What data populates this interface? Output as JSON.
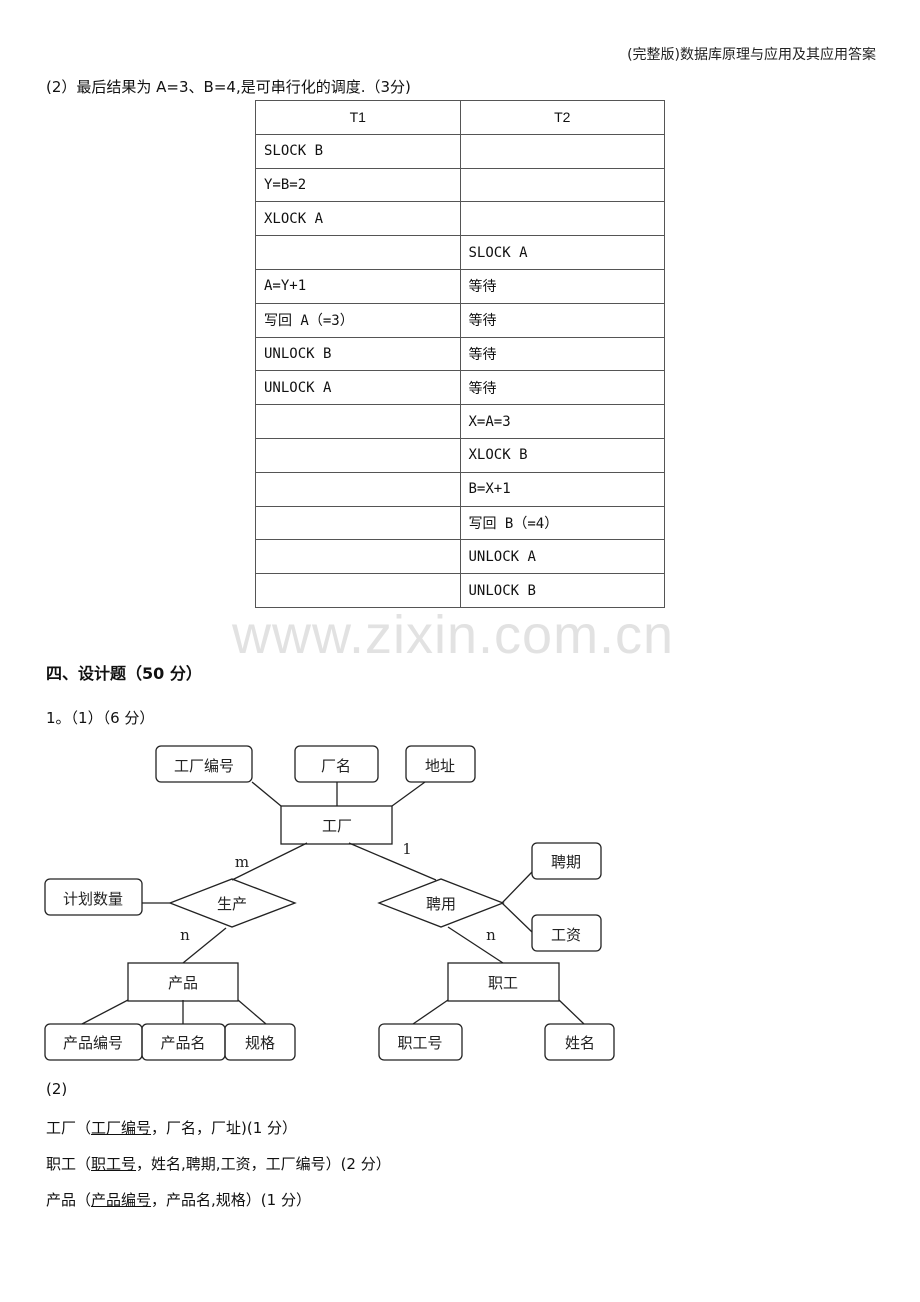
{
  "header": {
    "title": "(完整版)数据库原理与应用及其应用答案"
  },
  "q2_intro": "(2）最后结果为 A=3、B=4,是可串行化的调度.（3分)",
  "schedule_table": {
    "headers": [
      "T1",
      "T2"
    ],
    "rows": [
      [
        "SLOCK B",
        ""
      ],
      [
        "Y=B=2",
        ""
      ],
      [
        "XLOCK A",
        ""
      ],
      [
        "",
        "SLOCK A"
      ],
      [
        "A=Y+1",
        "等待"
      ],
      [
        "写回 A（=3）",
        "等待"
      ],
      [
        "UNLOCK B",
        "等待"
      ],
      [
        "UNLOCK A",
        "等待"
      ],
      [
        "",
        "X=A=3"
      ],
      [
        "",
        "XLOCK B"
      ],
      [
        "",
        "B=X+1"
      ],
      [
        "",
        "写回 B（=4）"
      ],
      [
        "",
        "UNLOCK A"
      ],
      [
        "",
        "UNLOCK B"
      ]
    ]
  },
  "watermark": "www.zixin.com.cn",
  "section4": {
    "title": "四、设计题（50 分）",
    "q1_label": "1。（1）（6 分）"
  },
  "er_diagram": {
    "entities": {
      "factory": "工厂",
      "product": "产品",
      "employee": "职工"
    },
    "relationships": {
      "produce": "生产",
      "hire": "聘用"
    },
    "attributes": {
      "factory_id": "工厂编号",
      "factory_name": "厂名",
      "address": "地址",
      "plan_qty": "计划数量",
      "hire_period": "聘期",
      "salary": "工资",
      "product_id": "产品编号",
      "product_name": "产品名",
      "spec": "规格",
      "employee_id": "职工号",
      "employee_name": "姓名"
    },
    "cardinalities": {
      "factory_produce": "m",
      "product_produce": "n",
      "factory_hire": "1",
      "employee_hire": "n"
    }
  },
  "part2": {
    "label": "(2)",
    "relations": [
      {
        "name": "工厂（",
        "key": "工厂编号",
        "rest": "，厂名，厂址)(1 分）"
      },
      {
        "name": "职工（",
        "key": "职工号",
        "rest": "，姓名,聘期,工资，工厂编号）(2 分）"
      },
      {
        "name": "产品（",
        "key": "产品编号",
        "rest": "，产品名,规格）(1 分）"
      }
    ]
  }
}
